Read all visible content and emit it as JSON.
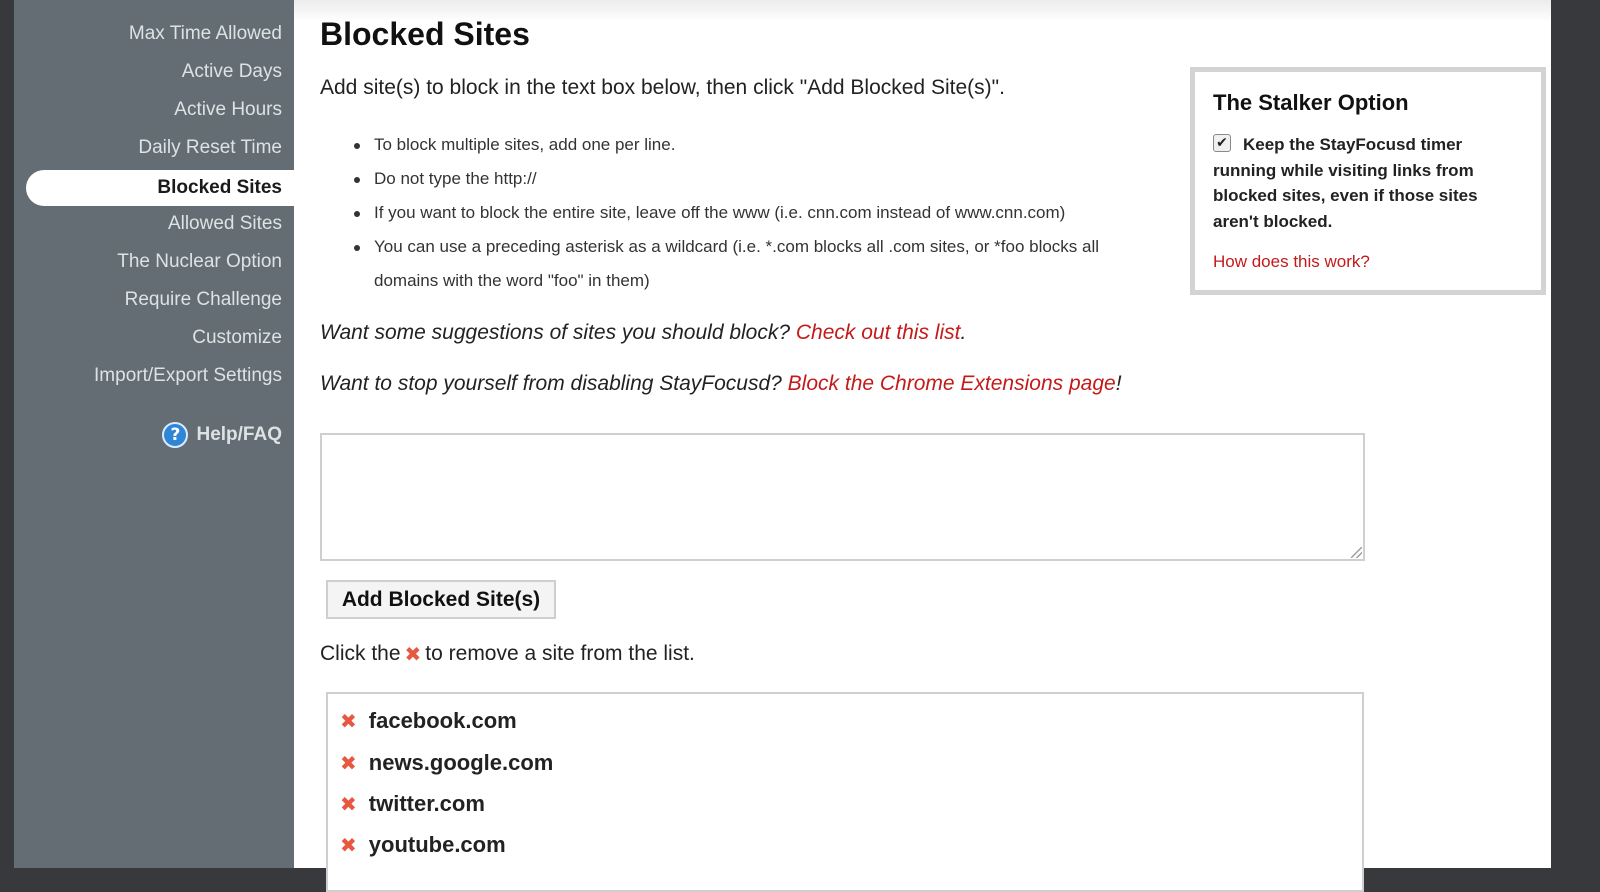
{
  "sidebar": {
    "items": [
      {
        "label": "Max Time Allowed"
      },
      {
        "label": "Active Days"
      },
      {
        "label": "Active Hours"
      },
      {
        "label": "Daily Reset Time"
      },
      {
        "label": "Blocked Sites",
        "active": true
      },
      {
        "label": "Allowed Sites"
      },
      {
        "label": "The Nuclear Option"
      },
      {
        "label": "Require Challenge"
      },
      {
        "label": "Customize"
      },
      {
        "label": "Import/Export Settings"
      }
    ],
    "help": {
      "label": "Help/FAQ",
      "icon": "question-circle-icon"
    }
  },
  "main": {
    "title": "Blocked Sites",
    "intro": "Add site(s) to block in the text box below, then click \"Add Blocked Site(s)\".",
    "tips": [
      "To block multiple sites, add one per line.",
      "Do not type the http://",
      "If you want to block the entire site, leave off the www (i.e. cnn.com instead of www.cnn.com)",
      "You can use a preceding asterisk as a wildcard (i.e. *.com blocks all .com sites, or *foo blocks all domains with the word \"foo\" in them)"
    ],
    "suggest1": {
      "text": "Want some suggestions of sites you should block? ",
      "link": "Check out this list",
      "suffix": "."
    },
    "suggest2": {
      "text": "Want to stop yourself from disabling StayFocusd? ",
      "link": "Block the Chrome Extensions page",
      "suffix": "!"
    },
    "input_value": "",
    "add_button": "Add Blocked Site(s)",
    "remove_hint_before": "Click the",
    "remove_hint_after": "to remove a site from the list.",
    "remove_icon": "red-x-icon",
    "sites": [
      "facebook.com",
      "news.google.com",
      "twitter.com",
      "youtube.com"
    ]
  },
  "stalker": {
    "title": "The Stalker Option",
    "checked": true,
    "text": "Keep the StayFocusd timer running while visiting links from blocked sites, even if those sites aren't blocked.",
    "link": "How does this work?"
  },
  "colors": {
    "sidebar_bg": "#636d73",
    "link_red": "#c41a1a",
    "remove_icon": "#e8573f",
    "frame": "#37393d"
  }
}
